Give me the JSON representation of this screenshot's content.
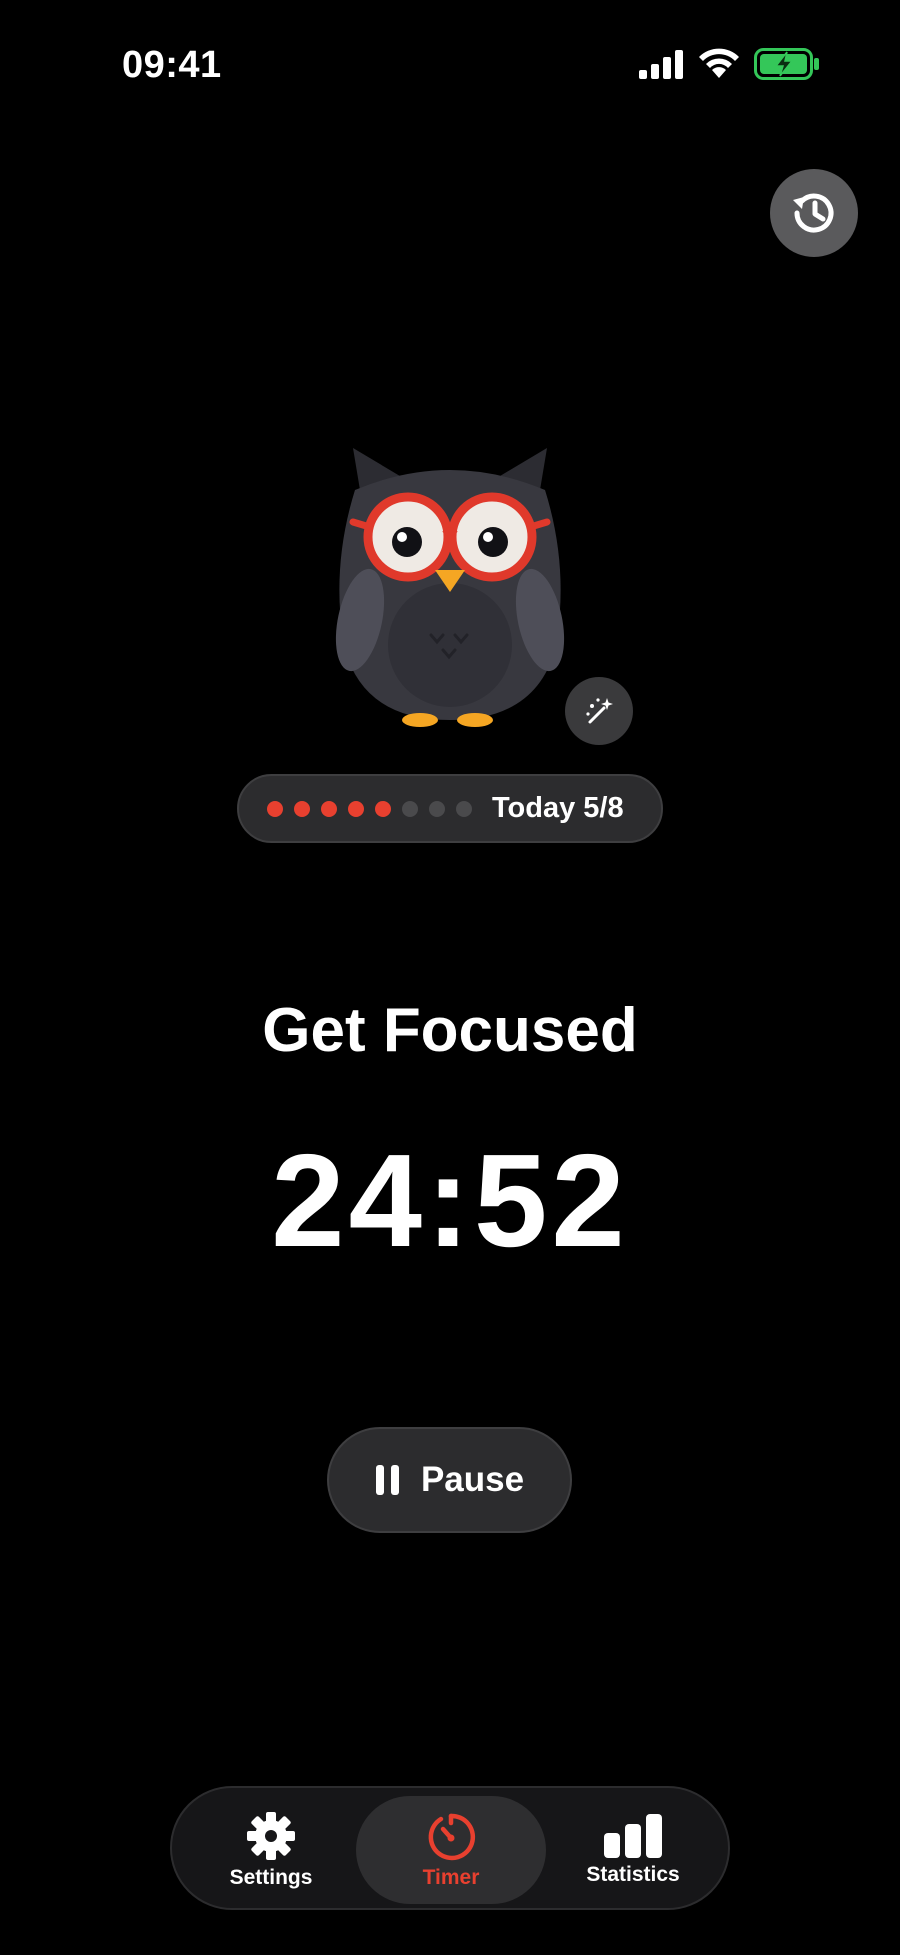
{
  "status_bar": {
    "time": "09:41",
    "icons": [
      "cellular-signal-icon",
      "wifi-icon",
      "battery-charging-icon"
    ],
    "battery_color": "#34c759"
  },
  "header": {
    "history_icon": "history-icon"
  },
  "mascot": {
    "name": "owl-with-glasses",
    "magic_icon": "magic-wand-icon"
  },
  "progress": {
    "completed": 5,
    "total": 8,
    "label": "Today 5/8",
    "done_color": "#e8402f",
    "pending_color": "#4a4a4c"
  },
  "main": {
    "mode_title": "Get Focused",
    "timer": "24:52"
  },
  "controls": {
    "pause_label": "Pause",
    "pause_icon": "pause-icon"
  },
  "tab_bar": {
    "active": "timer",
    "accent": "#e8402f",
    "tabs": [
      {
        "id": "settings",
        "label": "Settings",
        "icon": "gear-icon"
      },
      {
        "id": "timer",
        "label": "Timer",
        "icon": "stopwatch-icon"
      },
      {
        "id": "statistics",
        "label": "Statistics",
        "icon": "bar-chart-icon"
      }
    ]
  }
}
